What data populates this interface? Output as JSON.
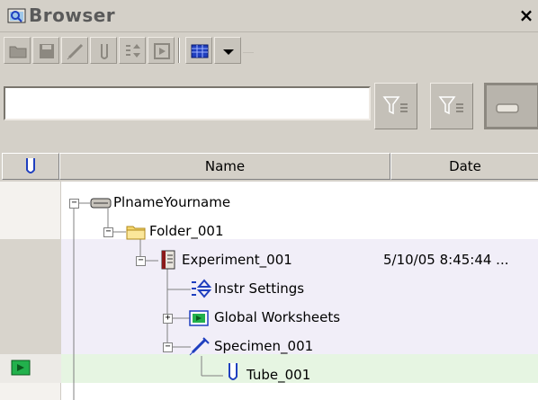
{
  "window": {
    "title": "Browser",
    "close_glyph": "×"
  },
  "toolbar": {
    "buttons": [
      {
        "icon": "folder-icon"
      },
      {
        "icon": "save-icon"
      },
      {
        "icon": "syringe-icon"
      },
      {
        "icon": "tube-icon"
      },
      {
        "icon": "instrument-settings-icon"
      },
      {
        "icon": "worksheet-icon"
      },
      {
        "icon": "grid-layout-icon"
      },
      {
        "icon": "dropdown-arrow-icon"
      }
    ]
  },
  "filter": {
    "search_value": "",
    "buttons": [
      {
        "icon": "filter-icon",
        "state": "normal"
      },
      {
        "icon": "filter-icon",
        "state": "normal"
      },
      {
        "icon": "server-icon",
        "state": "pressed"
      }
    ]
  },
  "columns": {
    "marker": "tube-icon",
    "name": "Name",
    "date": "Date"
  },
  "tree": {
    "root": {
      "label": "PlnameYourname",
      "icon": "server-icon"
    },
    "folder": {
      "label": "Folder_001",
      "icon": "folder-icon"
    },
    "experiment": {
      "label": "Experiment_001",
      "icon": "experiment-icon",
      "date": "5/10/05 8:45:44 ..."
    },
    "instr": {
      "label": "Instr Settings",
      "icon": "instrument-settings-icon"
    },
    "global": {
      "label": "Global Worksheets",
      "icon": "worksheet-icon"
    },
    "specimen": {
      "label": "Specimen_001",
      "icon": "syringe-icon"
    },
    "tube": {
      "label": "Tube_001",
      "icon": "tube-icon"
    }
  },
  "colors": {
    "chrome": "#d4d0c8",
    "selected_row": "#e6f5e2",
    "shaded_row": "#f1eef8",
    "accent_blue": "#1f3fbf",
    "accent_green": "#22b14c"
  }
}
